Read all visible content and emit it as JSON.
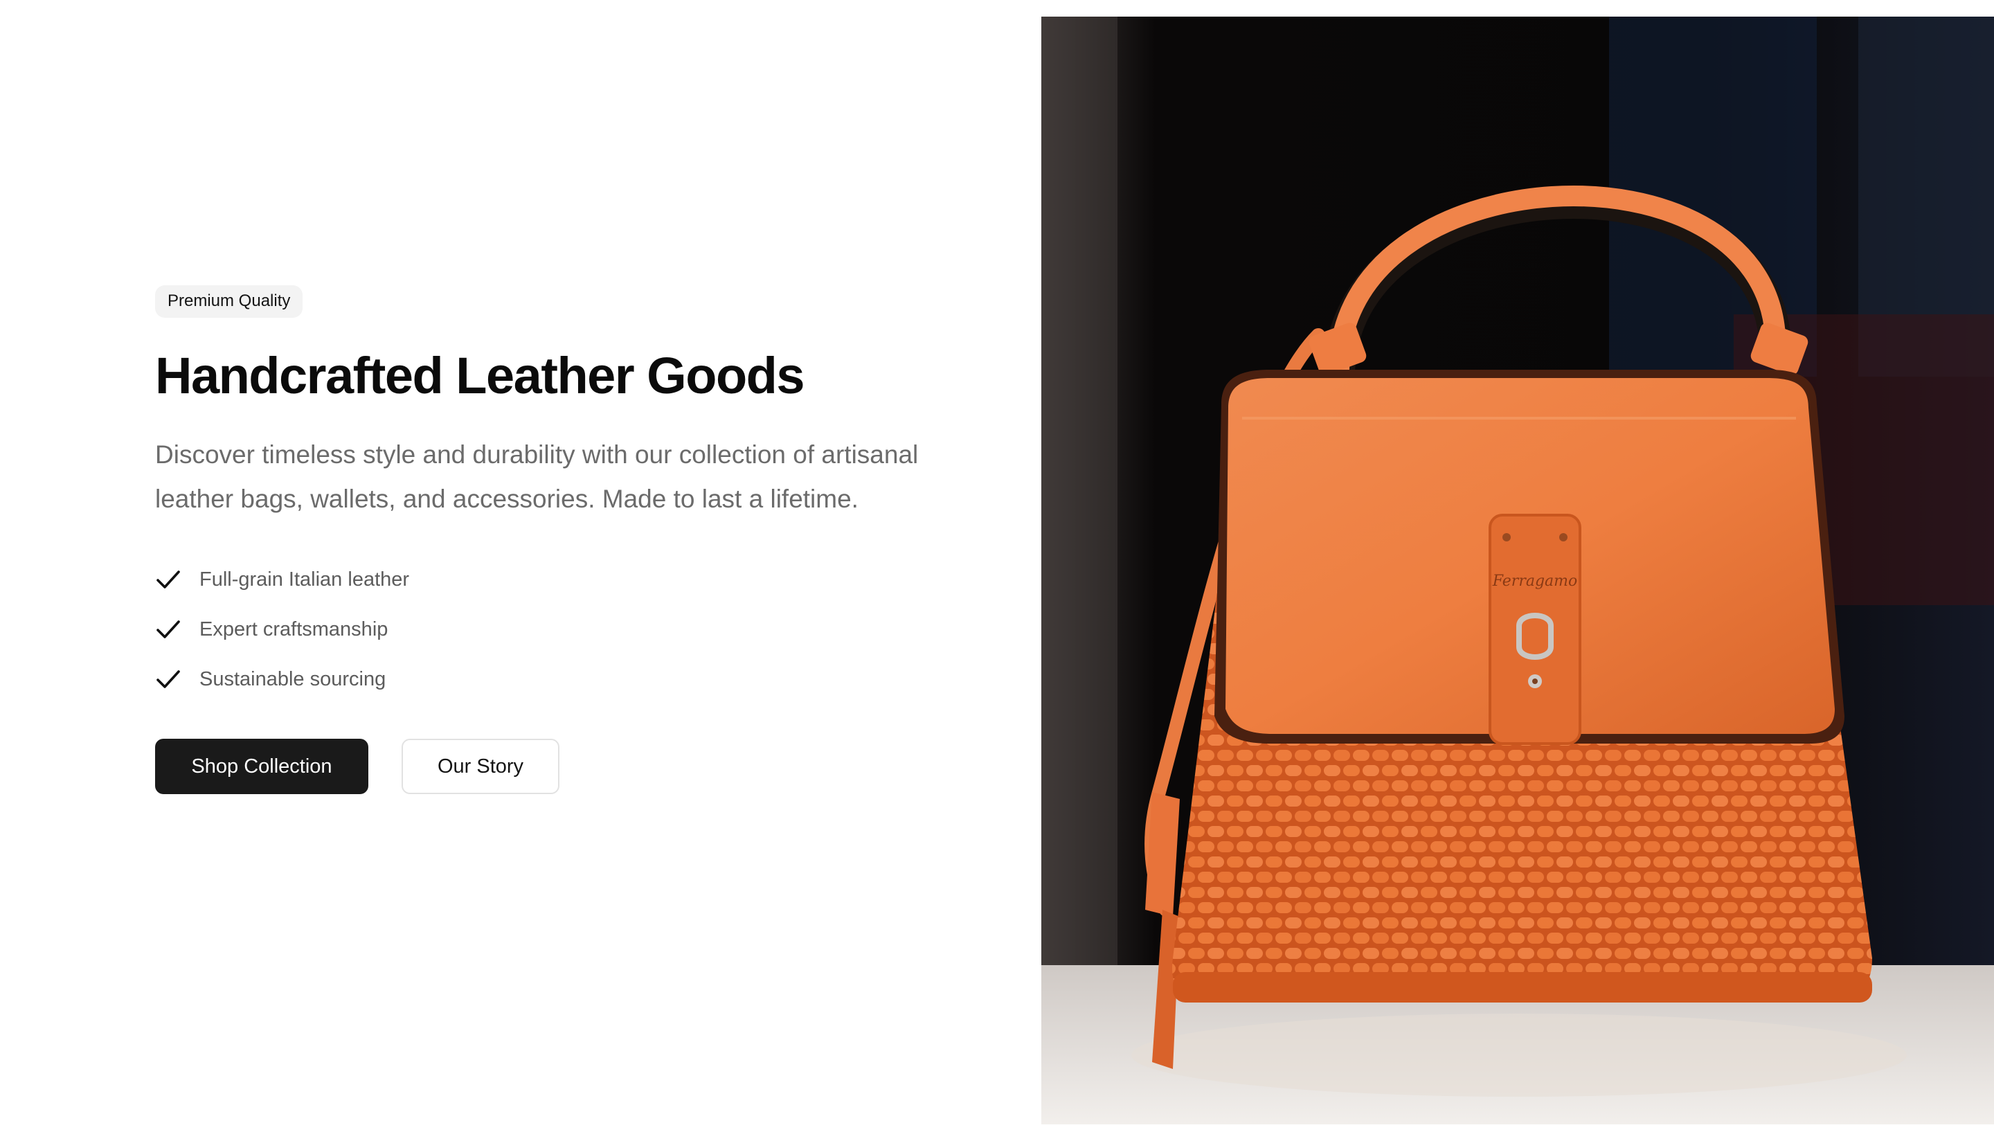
{
  "hero": {
    "badge": "Premium Quality",
    "title": "Handcrafted Leather Goods",
    "description": "Discover timeless style and durability with our collection of artisanal leather bags, wallets, and accessories. Made to last a lifetime.",
    "features": [
      {
        "icon": "check-icon",
        "label": "Full-grain Italian leather"
      },
      {
        "icon": "check-icon",
        "label": "Expert craftsmanship"
      },
      {
        "icon": "check-icon",
        "label": "Sustainable sourcing"
      }
    ],
    "primary_button": "Shop Collection",
    "secondary_button": "Our Story"
  },
  "image": {
    "subject": "orange woven basket handbag",
    "logo_text": "Ferragamo"
  },
  "colors": {
    "background": "#ffffff",
    "text_primary": "#0b0b0b",
    "text_muted": "#6b6b6b",
    "badge_bg": "#f3f3f3",
    "button_dark": "#1a1a1a",
    "bag_orange": "#ee7a3c"
  }
}
